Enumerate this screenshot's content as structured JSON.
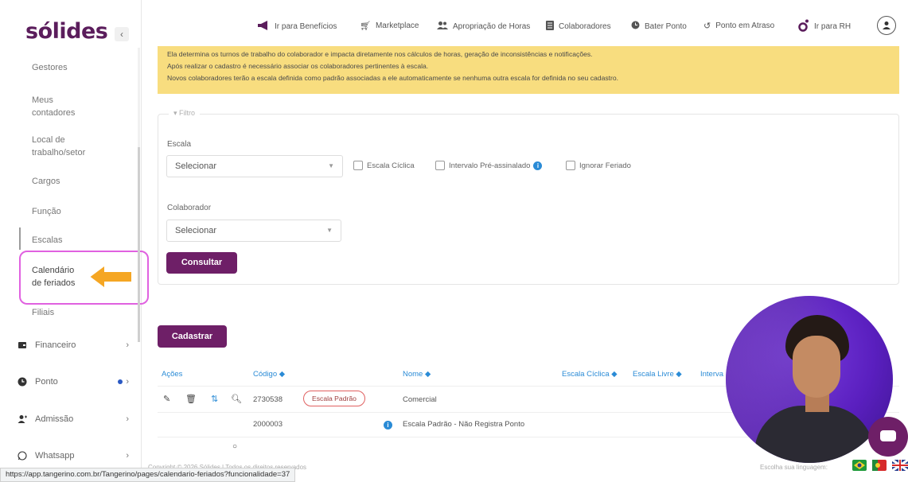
{
  "sidebar": {
    "logo": "sólides",
    "collapse": "‹",
    "items": [
      {
        "label": "Gestores"
      },
      {
        "label": "Meus contadores"
      },
      {
        "label": "Local de trabalho/setor"
      },
      {
        "label": "Cargos"
      },
      {
        "label": "Função"
      },
      {
        "label": "Escalas"
      },
      {
        "label": "Calendário de feriados"
      },
      {
        "label": "Filiais"
      }
    ],
    "groups": [
      {
        "label": "Financeiro",
        "icon": "wallet-icon"
      },
      {
        "label": "Ponto",
        "icon": "clock-icon"
      },
      {
        "label": "Admissão",
        "icon": "user-add-icon"
      },
      {
        "label": "Whatsapp",
        "icon": "whatsapp-icon"
      }
    ]
  },
  "topnav": {
    "items": [
      {
        "label": "Ir para Benefícios",
        "icon": "megaphone-icon"
      },
      {
        "label": "Marketplace",
        "icon": "cart-icon"
      },
      {
        "label": "Apropriação de Horas",
        "icon": "users-icon"
      },
      {
        "label": "Colaboradores",
        "icon": "list-icon"
      },
      {
        "label": "Bater Ponto",
        "icon": "clock-icon"
      },
      {
        "label": "Ponto em Atraso",
        "icon": "history-icon"
      },
      {
        "label": "Ir para RH",
        "icon": "solides-icon"
      }
    ]
  },
  "alert": {
    "line1": "Ela determina os turnos de trabalho do colaborador e impacta diretamente nos cálculos de horas, geração de inconsistências e notificações.",
    "line2": "Após realizar o cadastro é necessário associar os colaboradores pertinentes à escala.",
    "line3": "Novos colaboradores terão a escala definida como padrão associadas a ele automaticamente se nenhuma outra escala for definida no seu cadastro."
  },
  "filter": {
    "legend": "Filtro",
    "escala_label": "Escala",
    "escala_value": "Selecionar",
    "check_ciclica": "Escala Cíclica",
    "check_intervalo": "Intervalo Pré-assinalado",
    "check_feriado": "Ignorar Feriado",
    "colaborador_label": "Colaborador",
    "colaborador_value": "Selecionar",
    "consultar": "Consultar"
  },
  "cadastrar": "Cadastrar",
  "table": {
    "headers": {
      "acoes": "Ações",
      "codigo": "Código ◆",
      "nome": "Nome ◆",
      "ciclica": "Escala Cíclica ◆",
      "livre": "Escala Livre ◆",
      "interval": "Interva"
    },
    "rows": [
      {
        "codigo": "2730538",
        "badge": "Escala Padrão",
        "nome": "Comercial"
      },
      {
        "codigo": "2000003",
        "nome": "Escala Padrão - Não Registra Ponto"
      }
    ]
  },
  "footer": {
    "copyright": "Copyright © 2026 Sólides | Todos os direitos reservados",
    "language": "Escolha sua linguagem:"
  },
  "status_url": "https://app.tangerino.com.br/Tangerino/pages/calendario-feriados?funcionalidade=37",
  "colors": {
    "brand": "#6e1f67",
    "alert": "#f8dd7f",
    "link": "#2a8bd6",
    "highlight": "#e061e0",
    "arrow": "#f5a623"
  }
}
